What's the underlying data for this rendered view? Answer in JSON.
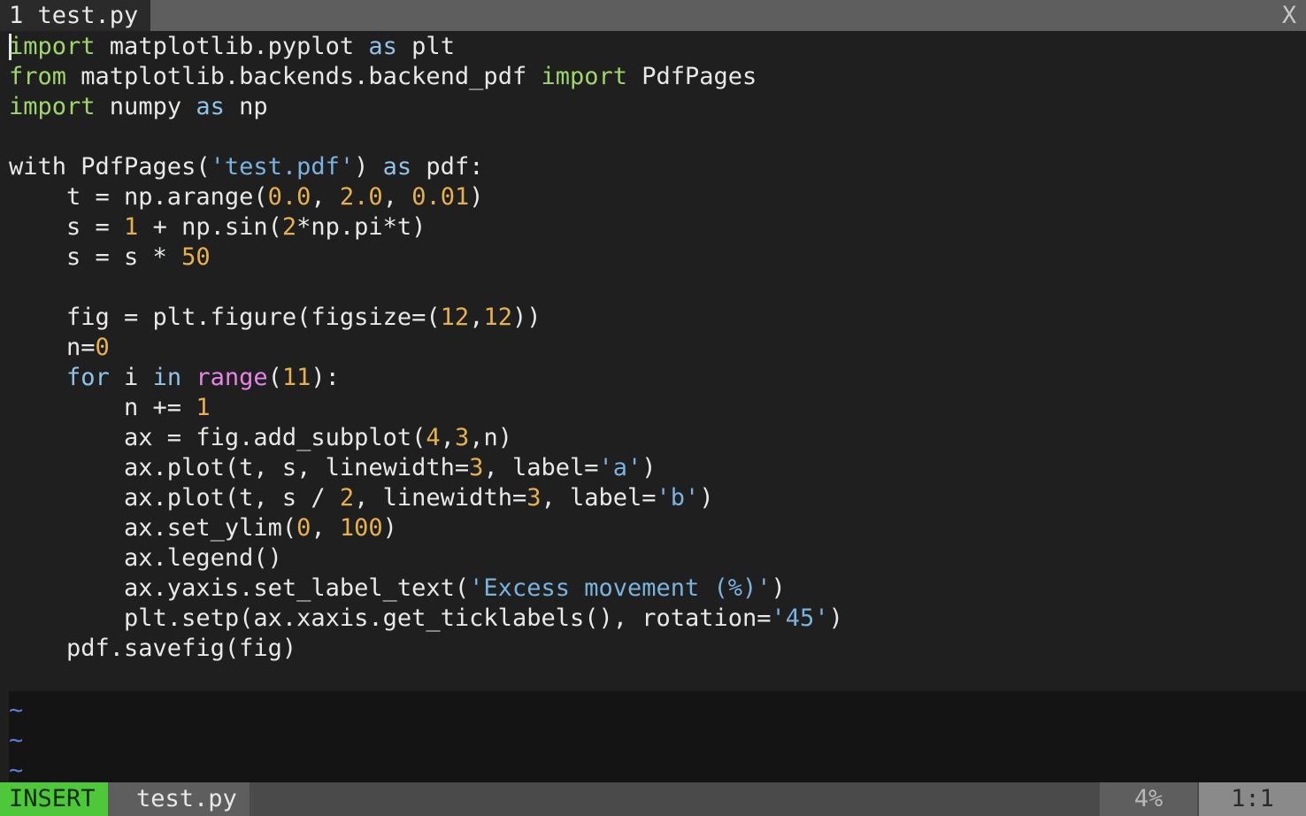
{
  "tabline": {
    "tab_label": "1 test.py",
    "close_label": "X"
  },
  "code": [
    [
      [
        "kw",
        "import"
      ],
      [
        "txt",
        " matplotlib.pyplot "
      ],
      [
        "kw2",
        "as"
      ],
      [
        "txt",
        " plt"
      ]
    ],
    [
      [
        "kw",
        "from"
      ],
      [
        "txt",
        " matplotlib.backends.backend_pdf "
      ],
      [
        "kw",
        "import"
      ],
      [
        "txt",
        " PdfPages"
      ]
    ],
    [
      [
        "kw",
        "import"
      ],
      [
        "txt",
        " numpy "
      ],
      [
        "kw2",
        "as"
      ],
      [
        "txt",
        " np"
      ]
    ],
    [],
    [
      [
        "txt",
        "with PdfPages("
      ],
      [
        "str",
        "'test.pdf'"
      ],
      [
        "txt",
        ") "
      ],
      [
        "kw2",
        "as"
      ],
      [
        "txt",
        " pdf:"
      ]
    ],
    [
      [
        "txt",
        "    t = np.arange("
      ],
      [
        "num",
        "0.0"
      ],
      [
        "txt",
        ", "
      ],
      [
        "num",
        "2.0"
      ],
      [
        "txt",
        ", "
      ],
      [
        "num",
        "0.01"
      ],
      [
        "txt",
        ")"
      ]
    ],
    [
      [
        "txt",
        "    s = "
      ],
      [
        "num",
        "1"
      ],
      [
        "txt",
        " + np.sin("
      ],
      [
        "num",
        "2"
      ],
      [
        "txt",
        "*np.pi*t)"
      ]
    ],
    [
      [
        "txt",
        "    s = s * "
      ],
      [
        "num",
        "50"
      ]
    ],
    [],
    [
      [
        "txt",
        "    fig = plt.figure(figsize=("
      ],
      [
        "num",
        "12"
      ],
      [
        "txt",
        ","
      ],
      [
        "num",
        "12"
      ],
      [
        "txt",
        "))"
      ]
    ],
    [
      [
        "txt",
        "    n="
      ],
      [
        "num",
        "0"
      ]
    ],
    [
      [
        "kw2",
        "    for"
      ],
      [
        "txt",
        " i "
      ],
      [
        "kw2",
        "in"
      ],
      [
        "txt",
        " "
      ],
      [
        "bi",
        "range"
      ],
      [
        "txt",
        "("
      ],
      [
        "num",
        "11"
      ],
      [
        "txt",
        "):"
      ]
    ],
    [
      [
        "txt",
        "        n += "
      ],
      [
        "num",
        "1"
      ]
    ],
    [
      [
        "txt",
        "        ax = fig.add_subplot("
      ],
      [
        "num",
        "4"
      ],
      [
        "txt",
        ","
      ],
      [
        "num",
        "3"
      ],
      [
        "txt",
        ",n)"
      ]
    ],
    [
      [
        "txt",
        "        ax.plot(t, s, linewidth="
      ],
      [
        "num",
        "3"
      ],
      [
        "txt",
        ", label="
      ],
      [
        "str",
        "'a'"
      ],
      [
        "txt",
        ")"
      ]
    ],
    [
      [
        "txt",
        "        ax.plot(t, s / "
      ],
      [
        "num",
        "2"
      ],
      [
        "txt",
        ", linewidth="
      ],
      [
        "num",
        "3"
      ],
      [
        "txt",
        ", label="
      ],
      [
        "str",
        "'b'"
      ],
      [
        "txt",
        ")"
      ]
    ],
    [
      [
        "txt",
        "        ax.set_ylim("
      ],
      [
        "num",
        "0"
      ],
      [
        "txt",
        ", "
      ],
      [
        "num",
        "100"
      ],
      [
        "txt",
        ")"
      ]
    ],
    [
      [
        "txt",
        "        ax.legend()"
      ]
    ],
    [
      [
        "txt",
        "        ax.yaxis.set_label_text("
      ],
      [
        "str",
        "'Excess movement (%)'"
      ],
      [
        "txt",
        ")"
      ]
    ],
    [
      [
        "txt",
        "        plt.setp(ax.xaxis.get_ticklabels(), rotation="
      ],
      [
        "str",
        "'45'"
      ],
      [
        "txt",
        ")"
      ]
    ],
    [
      [
        "txt",
        "    pdf.savefig(fig)"
      ]
    ],
    []
  ],
  "tildes": [
    "~",
    "~",
    "~"
  ],
  "statusbar": {
    "mode": "INSERT",
    "filename": "test.py",
    "percent": "4%",
    "position": "1:1"
  },
  "colors": {
    "keyword": "#9ed66b",
    "keyword_blue": "#8fc4e8",
    "string": "#79b3e0",
    "number": "#e6b04c",
    "builtin": "#e884e8",
    "mode_bg": "#4ec83a"
  }
}
